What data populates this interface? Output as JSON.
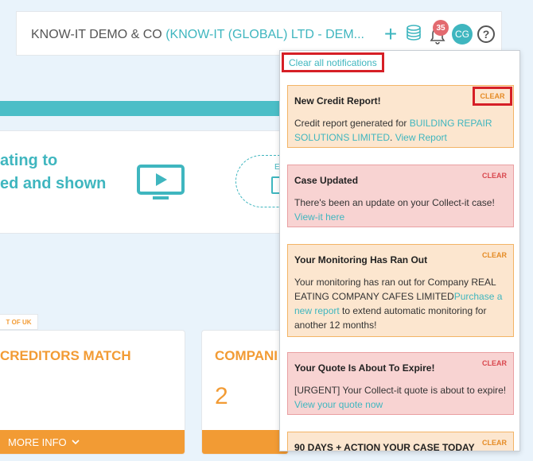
{
  "header": {
    "company_prefix": "KNOW-IT DEMO & CO ",
    "company_highlight": "(KNOW-IT (GLOBAL) LTD - DEM...",
    "add_icon": "plus-icon",
    "credits_icon": "coins-icon",
    "notifications_icon": "bell-icon",
    "notification_count": "35",
    "avatar_initials": "CG",
    "help_label": "?"
  },
  "hero": {
    "line1": "ating to",
    "line2": "ed and shown",
    "video_icon": "video-play-icon",
    "calendar_label": "E",
    "calendar_icon": "calendar-icon"
  },
  "tag": {
    "label": "T OF UK"
  },
  "cards": [
    {
      "title": "CREDITORS MATCH",
      "value": "",
      "footer": "MORE INFO"
    },
    {
      "title": "COMPANI",
      "value": "2",
      "footer": ""
    }
  ],
  "notifications": {
    "clear_all_label": "Clear all notifications",
    "clear_label": "CLEAR",
    "items": [
      {
        "title": "New Credit Report!",
        "body_text": "Credit report generated for ",
        "link1": "BUILDING REPAIR SOLUTIONS LIMITED",
        "middle": ". ",
        "link2": "View Report",
        "tail": ""
      },
      {
        "title": "Case Updated",
        "body_text": "There's been an update on your Collect-it case! ",
        "link1": "View-it here",
        "middle": "",
        "link2": "",
        "tail": ""
      },
      {
        "title": "Your Monitoring Has Ran Out",
        "body_text": "Your monitoring has ran out for Company REAL EATING COMPANY CAFES LIMITED",
        "link1": "Purchase a new report",
        "middle": " to extend automatic monitoring for another 12 months!",
        "link2": "",
        "tail": ""
      },
      {
        "title": "Your Quote Is About To Expire!",
        "body_text": "[URGENT] Your Collect-it quote is about to expire! ",
        "link1": "View your quote now",
        "middle": "",
        "link2": "",
        "tail": ""
      },
      {
        "title": "90 DAYS + ACTION YOUR CASE TODAY",
        "body_text": "",
        "link1": "",
        "middle": "",
        "link2": "",
        "tail": ""
      }
    ]
  },
  "colors": {
    "accent_teal": "#3fb6bf",
    "accent_orange": "#f29b34",
    "badge_red": "#e36a6f",
    "highlight_red": "#d61f26"
  }
}
